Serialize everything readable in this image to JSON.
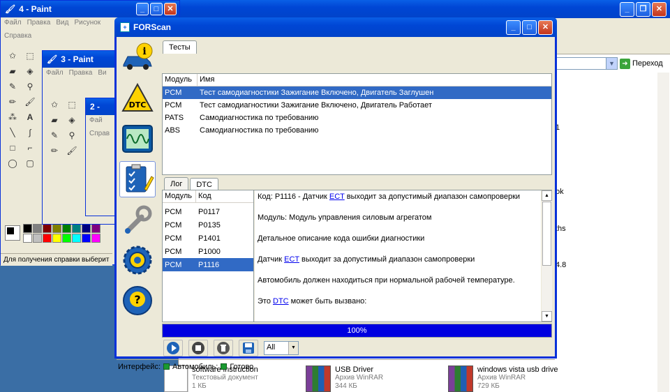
{
  "explorer": {
    "go_label": "Переход",
    "side_fragments": [
      "1",
      "ok",
      "ths",
      "4.8"
    ],
    "files": [
      {
        "name": "software instruction",
        "sub": "Текстовый документ",
        "sub2": "1 КБ"
      },
      {
        "name": "USB Driver",
        "sub": "Архив WinRAR",
        "sub2": "344 КБ"
      },
      {
        "name": "windows vista usb drive",
        "sub": "Архив WinRAR",
        "sub2": "729 КБ"
      }
    ]
  },
  "paint": {
    "win4_title": "4 - Paint",
    "win3_title": "3 - Paint",
    "win2_title": "2 -",
    "menu": [
      "Файл",
      "Правка",
      "Вид",
      "Рисунок",
      "Справка"
    ],
    "menu3": [
      "Файл",
      "Правка",
      "Ви"
    ],
    "menu2": [
      "Фай",
      "Справ"
    ],
    "status": "Для получения справки выберит",
    "palette": [
      "#000000",
      "#808080",
      "#800000",
      "#808000",
      "#008000",
      "#008080",
      "#000080",
      "#800080",
      "#ffffff",
      "#c0c0c0",
      "#ff0000",
      "#ffff00",
      "#00ff00",
      "#00ffff",
      "#0000ff",
      "#ff00ff"
    ]
  },
  "forscan": {
    "title": "FORScan",
    "tests_tab": "Тесты",
    "tests_headers": [
      "Модуль",
      "Имя"
    ],
    "tests_rows": [
      {
        "module": "PCM",
        "name": "Тест самодиагностики Зажигание Включено, Двигатель Заглушен",
        "selected": true
      },
      {
        "module": "PCM",
        "name": "Тест самодиагностики Зажигание Включено, Двигатель Работает",
        "selected": false
      },
      {
        "module": "PATS",
        "name": "Самодиагностика по требованию",
        "selected": false
      },
      {
        "module": "ABS",
        "name": "Самодиагностика по требованию",
        "selected": false
      }
    ],
    "log_tab": "Лог",
    "dtc_tab": "DTC",
    "dtc_headers": [
      "Модуль",
      "Код"
    ],
    "dtc_rows": [
      {
        "module": "PCM",
        "code": "P0117",
        "selected": false
      },
      {
        "module": "PCM",
        "code": "P0135",
        "selected": false
      },
      {
        "module": "PCM",
        "code": "P1401",
        "selected": false
      },
      {
        "module": "PCM",
        "code": "P1000",
        "selected": false
      },
      {
        "module": "PCM",
        "code": "P1116",
        "selected": true
      }
    ],
    "detail": {
      "line1_pre": "Код: P1116 - Датчик ",
      "line1_link": "ECT",
      "line1_post": " выходит за допустимый диапазон самопроверки",
      "module_line": "Модуль: Модуль управления силовым агрегатом",
      "desc_heading": "Детальное описание кода ошибки диагностики",
      "sensor_pre": "Датчик ",
      "sensor_link": "ECT",
      "sensor_post": " выходит за допустимый диапазон самопроверки",
      "car_line": "Автомобиль должен находиться при нормальной рабочей температуре.",
      "cause_pre": "Это ",
      "cause_link": "DTC",
      "cause_post": " может быть вызвано:"
    },
    "progress": {
      "value": 1.0,
      "label": "100%"
    },
    "filter_value": "All",
    "status": {
      "interface": "Интерфейс:",
      "car": "Автомобиль:",
      "ready": "Готово"
    }
  },
  "colors": {
    "xp_blue": "#0046d5",
    "selection": "#316ac5",
    "progress": "#0000e0",
    "led": "#1a9a31"
  }
}
